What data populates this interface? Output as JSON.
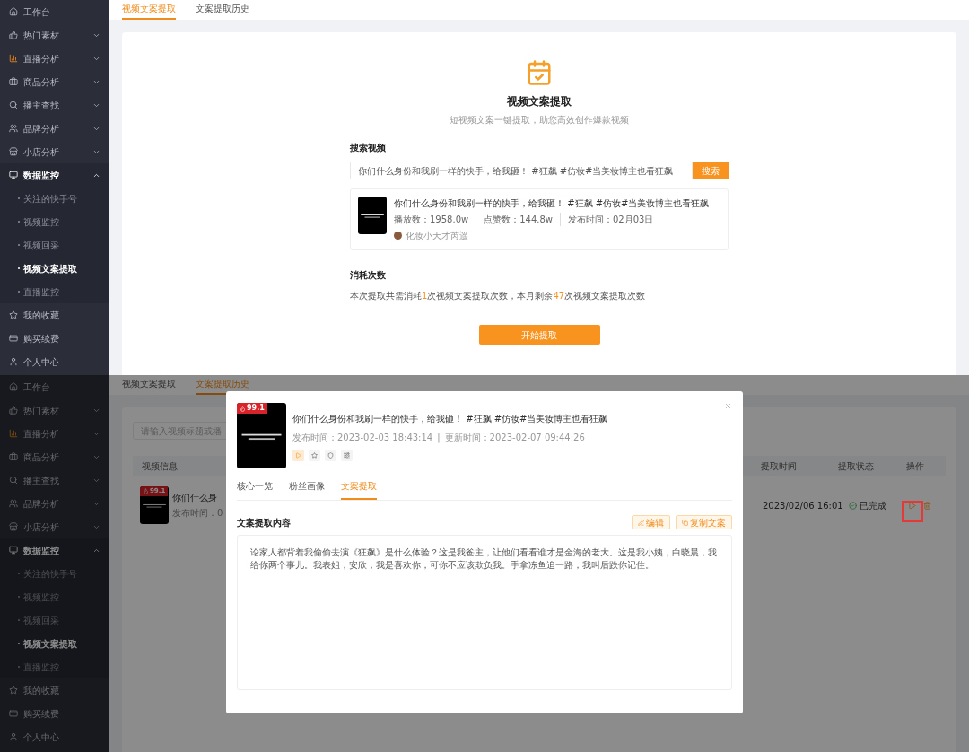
{
  "screens": [
    {
      "sidebar": [
        {
          "kind": "link",
          "label": "工作台"
        },
        {
          "kind": "group",
          "label": "热门素材",
          "expanded": false
        },
        {
          "kind": "group",
          "label": "直播分析",
          "expanded": false
        },
        {
          "kind": "group",
          "label": "商品分析",
          "expanded": false
        },
        {
          "kind": "group",
          "label": "播主查找",
          "expanded": false
        },
        {
          "kind": "group",
          "label": "品牌分析",
          "expanded": false
        },
        {
          "kind": "group",
          "label": "小店分析",
          "expanded": false
        },
        {
          "kind": "group",
          "label": "数据监控",
          "expanded": true,
          "children": [
            {
              "label": "关注的快手号",
              "selected": false
            },
            {
              "label": "视频监控",
              "selected": false
            },
            {
              "label": "视频回采",
              "selected": false
            },
            {
              "label": "视频文案提取",
              "selected": true
            },
            {
              "label": "直播监控",
              "selected": false
            }
          ]
        },
        {
          "kind": "link",
          "label": "我的收藏"
        },
        {
          "kind": "link",
          "label": "购买续费"
        },
        {
          "kind": "link",
          "label": "个人中心"
        }
      ],
      "tabs": [
        {
          "label": "视频文案提取",
          "selected": true
        },
        {
          "label": "文案提取历史",
          "selected": false
        }
      ],
      "extract_panel": {
        "title": "视频文案提取",
        "subtitle": "短视频文案一键提取，助您高效创作爆款视频",
        "search_label": "搜索视频",
        "search_value": "你们什么身份和我刷一样的快手，给我砸！ #狂飙 #仿妆#当美妆博主也看狂飙",
        "search_button": "搜索",
        "result": {
          "title": "你们什么身份和我刷一样的快手，给我砸！ #狂飙 #仿妆#当美妆博主也看狂飙",
          "stats": [
            "播放数：1958.0w",
            "点赞数：144.8w",
            "发布时间：02月03日"
          ],
          "author": "化妆小天才芮遥"
        },
        "usage_label": "消耗次数",
        "usage_parts": [
          {
            "text": "本次提取共需消耗",
            "highlight": false
          },
          {
            "text": "1",
            "highlight": true
          },
          {
            "text": "次视频文案提取次数，本月剩余",
            "highlight": false
          },
          {
            "text": "47",
            "highlight": true
          },
          {
            "text": "次视频文案提取次数",
            "highlight": false
          }
        ],
        "start_button": "开始提取"
      }
    },
    {
      "sidebar": [
        {
          "kind": "link",
          "label": "工作台"
        },
        {
          "kind": "group",
          "label": "热门素材",
          "expanded": false
        },
        {
          "kind": "group",
          "label": "直播分析",
          "expanded": false
        },
        {
          "kind": "group",
          "label": "商品分析",
          "expanded": false
        },
        {
          "kind": "group",
          "label": "播主查找",
          "expanded": false
        },
        {
          "kind": "group",
          "label": "品牌分析",
          "expanded": false
        },
        {
          "kind": "group",
          "label": "小店分析",
          "expanded": false
        },
        {
          "kind": "group",
          "label": "数据监控",
          "expanded": true,
          "children": [
            {
              "label": "关注的快手号",
              "selected": false
            },
            {
              "label": "视频监控",
              "selected": false
            },
            {
              "label": "视频回采",
              "selected": false
            },
            {
              "label": "视频文案提取",
              "selected": true
            },
            {
              "label": "直播监控",
              "selected": false
            }
          ]
        },
        {
          "kind": "link",
          "label": "我的收藏"
        },
        {
          "kind": "link",
          "label": "购买续费"
        },
        {
          "kind": "link",
          "label": "个人中心"
        }
      ],
      "tabs": [
        {
          "label": "视频文案提取",
          "selected": false
        },
        {
          "label": "文案提取历史",
          "selected": true
        }
      ],
      "history": {
        "search_placeholder": "请输入视频标题或播",
        "columns": [
          "视频信息",
          "提取时间",
          "提取状态",
          "操作"
        ],
        "rows": [
          {
            "badge": "99.1",
            "title": "你们什么身",
            "meta": "发布时间：0",
            "time": "2023/02/06 16:01",
            "status": "已完成"
          }
        ]
      },
      "modal": {
        "badge": "99.1",
        "title": "你们什么身份和我刷一样的快手，给我砸！ #狂飙 #仿妆#当美妆博主也看狂飙",
        "published": "发布时间：2023-02-03 18:43:14",
        "separator": "|",
        "updated": "更新时间：2023-02-07 09:44:26",
        "icon_buttons": [
          {
            "kind": "play",
            "selected": true
          },
          {
            "kind": "star",
            "selected": false
          },
          {
            "kind": "shield",
            "selected": false
          },
          {
            "kind": "qr",
            "selected": false
          }
        ],
        "tabs": [
          {
            "label": "核心一览",
            "selected": false
          },
          {
            "label": "粉丝画像",
            "selected": false
          },
          {
            "label": "文案提取",
            "selected": true
          }
        ],
        "section_title": "文案提取内容",
        "actions": [
          {
            "kind": "edit",
            "label": "编辑"
          },
          {
            "kind": "copy",
            "label": "复制文案"
          }
        ],
        "content": "论家人都背着我偷偷去演《狂飙》是什么体验？这是我爸主，让他们看看谁才是金海的老大。这是我小姨，白晓晨，我给你两个事儿。我表姐，安欣，我是喜欢你，可你不应该欺负我。手拿冻鱼追一路，我叫后跌你记住。"
      }
    }
  ]
}
